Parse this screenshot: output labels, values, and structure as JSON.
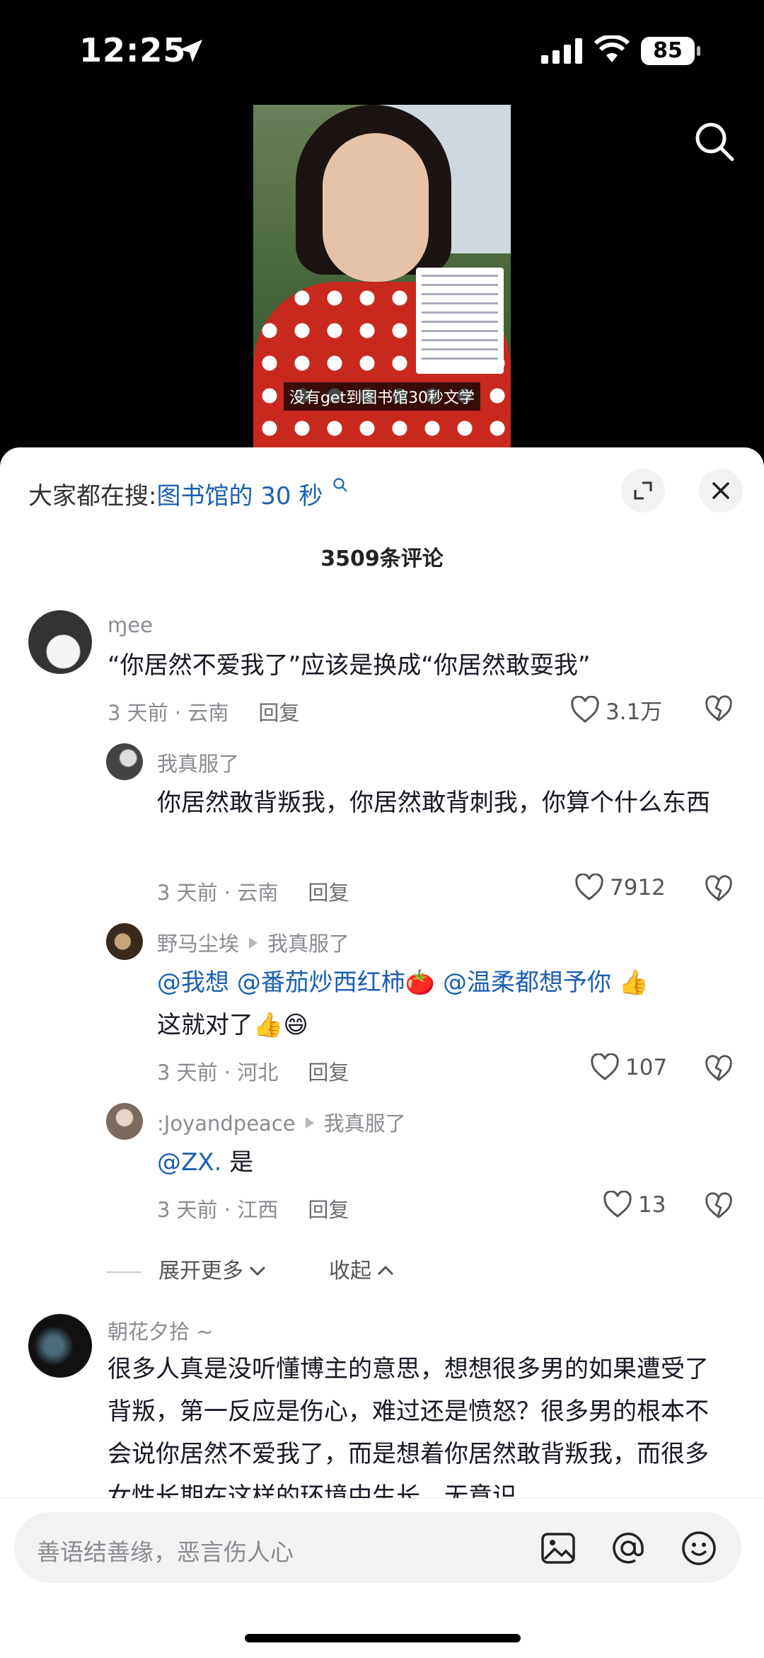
{
  "status_bar": {
    "time": "12:25",
    "battery": "85"
  },
  "video": {
    "caption": "没有get到图书馆30秒文学"
  },
  "hot_search": {
    "label": "大家都在搜:",
    "keyword": "图书馆的 30 秒"
  },
  "comments_count": "3509条评论",
  "comments": [
    {
      "name": "ɱee",
      "text": "“你居然不爱我了”应该是换成“你居然敢耍我”",
      "time": "3 天前 · 云南",
      "reply": "回复",
      "likes": "3.1万"
    },
    {
      "name": "朝花夕拾 ~",
      "text": "很多人真是没听懂博主的意思，想想很多男的如果遭受了背叛，第一反应是伤心，难过还是愤怒？很多男的根本不会说你居然不爱我了，而是想着你居然敢背叛我，而很多女性长期在这样的环境中生长，无意识"
    }
  ],
  "replies": [
    {
      "name": "我真服了",
      "text": "你居然敢背叛我，你居然敢背刺我，你算个什么东西",
      "time": "3 天前 · 云南",
      "reply": "回复",
      "likes": "7912"
    },
    {
      "name": "野马尘埃",
      "to": "我真服了",
      "mentions": [
        "@我想",
        "@番茄炒西红柿",
        "@温柔都想予你"
      ],
      "emoji1": "🍅",
      "emoji2": "👍",
      "text2": "这就对了",
      "emoji3": "👍😄",
      "time": "3 天前 · 河北",
      "reply": "回复",
      "likes": "107"
    },
    {
      "name": ":Joyandpeace",
      "to": "我真服了",
      "mention": "@ZX.",
      "text": " 是",
      "time": "3 天前 · 江西",
      "reply": "回复",
      "likes": "13"
    }
  ],
  "thread_controls": {
    "expand": "展开更多",
    "collapse": "收起"
  },
  "input": {
    "placeholder": "善语结善缘，恶言伤人心"
  }
}
